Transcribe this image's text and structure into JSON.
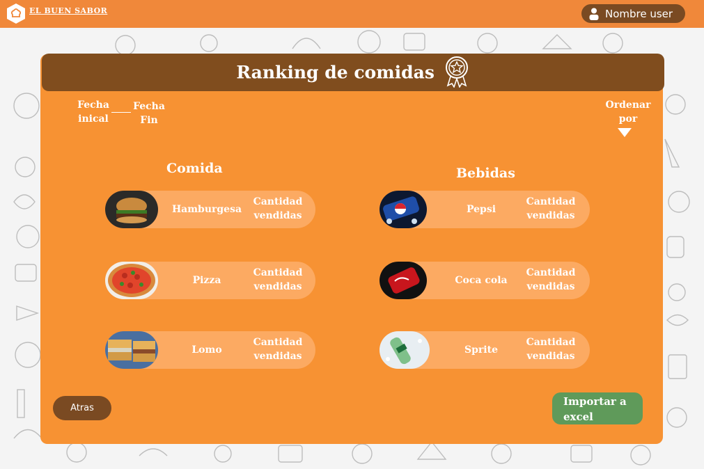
{
  "topbar": {
    "brand": "EL BUEN SABOR",
    "user_name": "Nombre user",
    "logo_icon": "chef-hat-icon",
    "user_icon": "person-icon"
  },
  "page": {
    "title": "Ranking de comidas",
    "title_icon": "award-badge-icon",
    "date_from": "Fecha inical",
    "date_to": "Fecha Fin",
    "sort_label": "Ordenar por",
    "back_label": "Atras",
    "export_label": "Importar a excel"
  },
  "food": {
    "title": "Comida",
    "items": [
      {
        "name": "Hamburgesa",
        "qty_label": "Cantidad vendidas",
        "image": "burger-image"
      },
      {
        "name": "Pizza",
        "qty_label": "Cantidad vendidas",
        "image": "pizza-image"
      },
      {
        "name": "Lomo",
        "qty_label": "Cantidad vendidas",
        "image": "sandwich-image"
      }
    ]
  },
  "drinks": {
    "title": "Bebidas",
    "items": [
      {
        "name": "Pepsi",
        "qty_label": "Cantidad vendidas",
        "image": "pepsi-can-image"
      },
      {
        "name": "Coca cola",
        "qty_label": "Cantidad vendidas",
        "image": "coca-cola-can-image"
      },
      {
        "name": "Sprite",
        "qty_label": "Cantidad vendidas",
        "image": "sprite-bottle-image"
      }
    ]
  },
  "colors": {
    "topbar": "#f0883a",
    "panel": "#f79233",
    "title_bar": "#804d1e",
    "item_pill": "#fcaa62",
    "back_button": "#7a4a22",
    "export_button": "#5f9a5a"
  }
}
